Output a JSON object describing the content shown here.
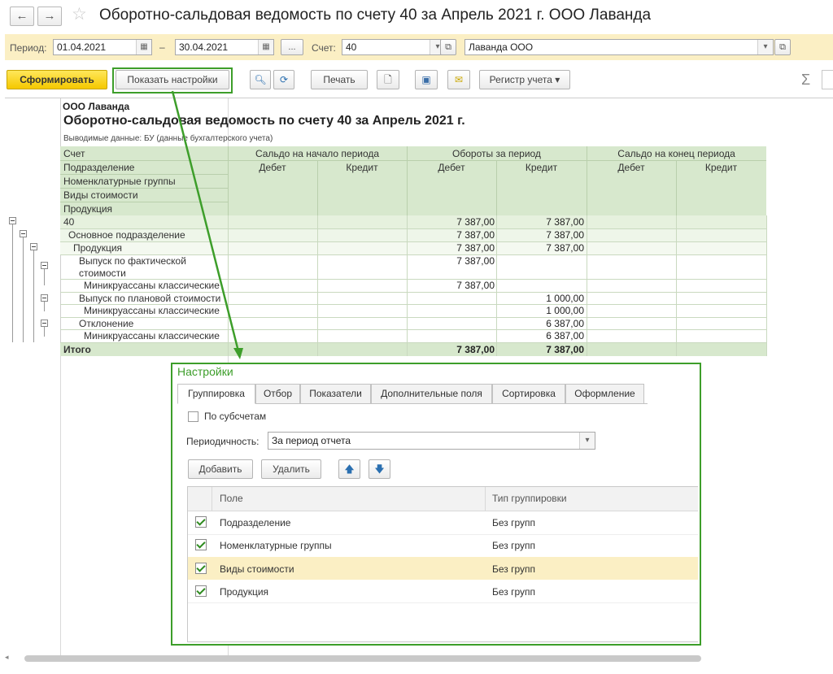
{
  "window": {
    "title": "Оборотно-сальдовая ведомость по счету 40 за Апрель 2021 г. ООО Лаванда",
    "back_icon": "←",
    "forward_icon": "→",
    "star_icon": "☆"
  },
  "params": {
    "period_label": "Период:",
    "date_from": "01.04.2021",
    "dash": "–",
    "date_to": "30.04.2021",
    "ellipsis": "...",
    "account_label": "Счет:",
    "account": "40",
    "org": "Лаванда ООО"
  },
  "toolbar": {
    "generate": "Сформировать",
    "show_settings": "Показать настройки",
    "print": "Печать",
    "register": "Регистр учета",
    "sigma": "Σ"
  },
  "report": {
    "org": "ООО Лаванда",
    "title": "Оборотно-сальдовая ведомость по счету 40 за Апрель 2021 г.",
    "subtitle": "Выводимые данные:  БУ (данные бухгалтерского учета)",
    "dim_headers": [
      "Счет",
      "Подразделение",
      "Номенклатурные группы",
      "Виды стоимости",
      "Продукция"
    ],
    "group_headers": [
      "Сальдо на начало периода",
      "Обороты за период",
      "Сальдо на конец периода"
    ],
    "debit": "Дебет",
    "credit": "Кредит",
    "rows": [
      {
        "label": "40",
        "d2": "7 387,00",
        "c2": "7 387,00"
      },
      {
        "label": "Основное подразделение",
        "d2": "7 387,00",
        "c2": "7 387,00"
      },
      {
        "label": "Продукция",
        "d2": "7 387,00",
        "c2": "7 387,00"
      },
      {
        "label": "Выпуск по фактической",
        "label2": "стоимости",
        "d2": "7 387,00",
        "c2": ""
      },
      {
        "label": "Миникруассаны классические",
        "d2": "7 387,00",
        "c2": ""
      },
      {
        "label": "Выпуск по плановой стоимости",
        "d2": "",
        "c2": "1 000,00"
      },
      {
        "label": "Миникруассаны классические",
        "d2": "",
        "c2": "1 000,00"
      },
      {
        "label": "Отклонение",
        "d2": "",
        "c2": "6 387,00"
      },
      {
        "label": "Миникруассаны классические",
        "d2": "",
        "c2": "6 387,00"
      }
    ],
    "total": {
      "label": "Итого",
      "d2": "7 387,00",
      "c2": "7 387,00"
    }
  },
  "settings": {
    "title": "Настройки",
    "tabs": [
      "Группировка",
      "Отбор",
      "Показатели",
      "Дополнительные поля",
      "Сортировка",
      "Оформление"
    ],
    "by_subaccounts": "По субсчетам",
    "periodicity_label": "Периодичность:",
    "periodicity": "За период отчета",
    "add": "Добавить",
    "delete": "Удалить",
    "up_icon": "🡅",
    "down_icon": "🡇",
    "col_field": "Поле",
    "col_type": "Тип группировки",
    "rows": [
      {
        "field": "Подразделение",
        "type": "Без групп"
      },
      {
        "field": "Номенклатурные группы",
        "type": "Без групп"
      },
      {
        "field": "Виды стоимости",
        "type": "Без групп"
      },
      {
        "field": "Продукция",
        "type": "Без групп"
      }
    ]
  },
  "colors": {
    "accent_yellow": "#f5c800",
    "highlight_green": "#3d9e2a",
    "group_header": "#d7e8cd",
    "selected_row": "#fbefc4"
  }
}
